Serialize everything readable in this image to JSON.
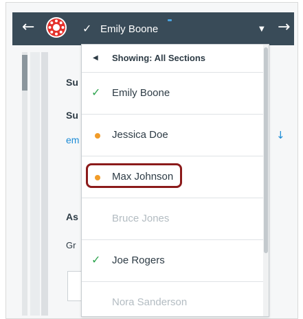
{
  "topbar": {
    "back_icon": "arrow-left-icon",
    "logo_icon": "canvas-logo-icon",
    "current_student": "Emily Boone",
    "current_student_icon": "check-icon",
    "dropdown_icon": "caret-down-icon",
    "forward_icon": "arrow-right-icon",
    "bar_color": "#394b58"
  },
  "background": {
    "line1": "Su",
    "line2": "Su",
    "link": "em",
    "heading": "As",
    "sub": "Gr",
    "download_icon": "download-arrow-icon"
  },
  "dropdown": {
    "header": "Showing: All Sections",
    "header_icon": "triangle-left-icon",
    "students": [
      {
        "name": "Emily Boone",
        "status": "graded",
        "icon": "check-icon"
      },
      {
        "name": "Jessica Doe",
        "status": "needs-grading",
        "icon": "dot-icon"
      },
      {
        "name": "Max Johnson",
        "status": "needs-grading",
        "icon": "dot-icon",
        "highlighted": true
      },
      {
        "name": "Bruce Jones",
        "status": "not-submitted",
        "icon": ""
      },
      {
        "name": "Joe Rogers",
        "status": "graded",
        "icon": "check-icon"
      },
      {
        "name": "Nora Sanderson",
        "status": "not-submitted",
        "icon": ""
      }
    ],
    "colors": {
      "check": "#2ea44f",
      "dot": "#f19c29",
      "highlight": "#8b1a1a",
      "muted_text": "#b3bcc2"
    }
  }
}
